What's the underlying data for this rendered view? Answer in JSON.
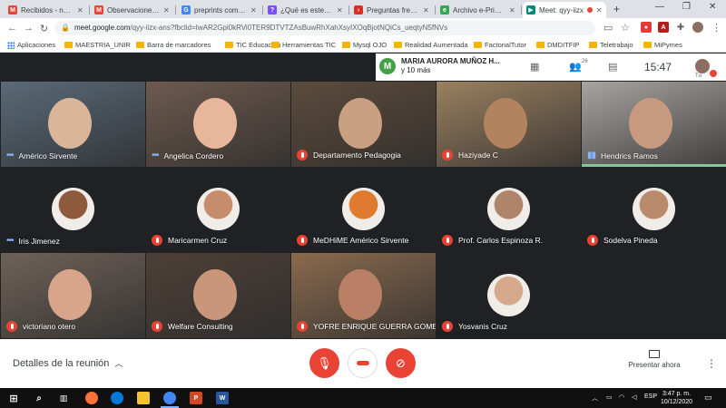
{
  "browser": {
    "tabs": [
      {
        "title": "Recibidos - nsanc",
        "icon": "gmail-icon",
        "color": "#ea4335",
        "glyph": "M"
      },
      {
        "title": "Observaciones de",
        "icon": "gmail-icon",
        "color": "#ea4335",
        "glyph": "M"
      },
      {
        "title": "preprints como Ar",
        "icon": "google-icon",
        "color": "#4285f4",
        "glyph": "G"
      },
      {
        "title": "¿Qué es este asun",
        "icon": "doc-icon",
        "color": "#7c4dff",
        "glyph": "?"
      },
      {
        "title": "Preguntas frecuer",
        "icon": "play-icon",
        "color": "#d93025",
        "glyph": "›"
      },
      {
        "title": "Archivo e-Print de",
        "icon": "archive-icon",
        "color": "#34a853",
        "glyph": "e"
      },
      {
        "title": "Meet: qyy-iizx",
        "icon": "meet-icon",
        "color": "#00897b",
        "glyph": "▶"
      }
    ],
    "new_tab": "+",
    "window_controls": {
      "minimize": "—",
      "maximize": "❐",
      "close": "✕"
    },
    "url_host": "meet.google.com",
    "url_path": "/qyy-iizx-ans?fbclid=IwAR2Gpi0kRVi0TER9DTVTZAsBuwRhXahXsyIXOqBjotNQiCs_ueqtyN5fNVs",
    "bookmarks": [
      {
        "label": "Aplicaciones",
        "type": "apps"
      },
      {
        "label": "MAESTRIA_UNIR",
        "type": "folder"
      },
      {
        "label": "Barra de marcadores",
        "type": "folder"
      },
      {
        "label": "TIC Educacion",
        "type": "folder"
      },
      {
        "label": "Herramientas TIC",
        "type": "folder"
      },
      {
        "label": "Mysql OJO",
        "type": "folder"
      },
      {
        "label": "Realidad Aumentada",
        "type": "folder"
      },
      {
        "label": "FactorialTutor",
        "type": "folder"
      },
      {
        "label": "DMDITFIP",
        "type": "folder"
      },
      {
        "label": "Teletrabajo",
        "type": "folder"
      },
      {
        "label": "MiPymes",
        "type": "folder"
      }
    ]
  },
  "meet": {
    "presenter": {
      "initial": "M",
      "name": "MARIA AURORA MUÑOZ H...",
      "others": "y 10 más"
    },
    "participants_count": "26",
    "time": "15:47",
    "self_label": "Tú",
    "participants": [
      {
        "name": "Américo Sirvente",
        "status": "speaking-dots",
        "bg": "#5a6a78",
        "face": "#d9b59a"
      },
      {
        "name": "Angelica Cordero",
        "status": "speaking-dots",
        "bg": "#6d5a4e",
        "face": "#e8b79b"
      },
      {
        "name": "Departamento Pedagogia",
        "status": "muted",
        "bg": "#5c4b3c",
        "face": "#caa083"
      },
      {
        "name": "Haziyade C",
        "status": "muted",
        "bg": "#9a8060",
        "face": "#b3825f"
      },
      {
        "name": "Hendrics Ramos",
        "status": "active-speaker",
        "bg": "#a8a4a0",
        "face": "#c79a80"
      },
      {
        "name": "Iris Jimenez",
        "status": "speaking-dots",
        "bg": "#202124",
        "face": "#8d5a3c",
        "avatar": true
      },
      {
        "name": "Maricarmen Cruz",
        "status": "muted",
        "bg": "#202124",
        "face": "#c68c6c",
        "avatar": true
      },
      {
        "name": "MeDHiME Américo Sirvente",
        "status": "muted",
        "bg": "#202124",
        "face": "#e07a2e",
        "avatar": true
      },
      {
        "name": "Prof. Carlos Espinoza R.",
        "status": "muted",
        "bg": "#202124",
        "face": "#b0846a",
        "avatar": true
      },
      {
        "name": "Sodelva Pineda",
        "status": "muted",
        "bg": "#202124",
        "face": "#b98a6c",
        "avatar": true
      },
      {
        "name": "victoriano otero",
        "status": "muted",
        "bg": "#6e6258",
        "face": "#d9a58a"
      },
      {
        "name": "Welfare Consulting",
        "status": "muted",
        "bg": "#4d4038",
        "face": "#c9967a"
      },
      {
        "name": "YOFRE ENRIQUE GUERRA GOMEZ",
        "status": "muted",
        "bg": "#8a6a4e",
        "face": "#b98066"
      },
      {
        "name": "Yosvanis Cruz",
        "status": "muted",
        "bg": "#202124",
        "face": "#d6a88c",
        "avatar": true
      }
    ],
    "details_label": "Detalles de la reunión",
    "present_label": "Presentar ahora"
  },
  "taskbar": {
    "lang": "ESP",
    "time": "3:47 p. m.",
    "date": "10/12/2020"
  }
}
